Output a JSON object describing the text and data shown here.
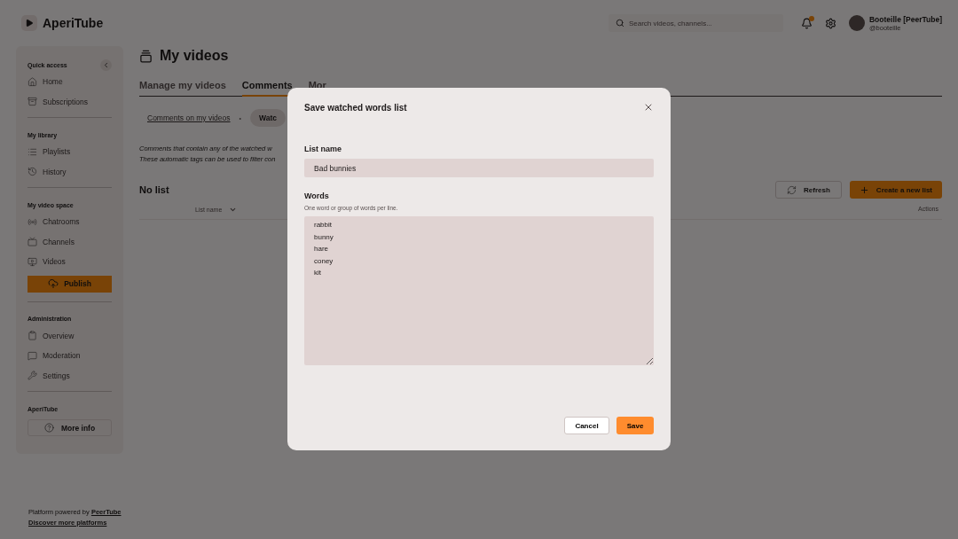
{
  "header": {
    "logo": "AperiTube",
    "search": {
      "placeholder": "Search videos, channels..."
    },
    "notifications": {
      "unread": true
    },
    "user": {
      "name": "Booteille [PeerTube]",
      "handle": "@booteille"
    }
  },
  "sidebar": {
    "sections": [
      {
        "title": "Quick access",
        "items": [
          "Home",
          "Subscriptions"
        ]
      },
      {
        "title": "My library",
        "items": [
          "Playlists",
          "History"
        ]
      },
      {
        "title": "My video space",
        "items": [
          "Chatrooms",
          "Channels",
          "Videos"
        ],
        "action": "Publish"
      },
      {
        "title": "Administration",
        "items": [
          "Overview",
          "Moderation",
          "Settings"
        ]
      },
      {
        "title": "AperiTube",
        "action": "More info"
      }
    ]
  },
  "footer": {
    "powered": "Platform powered by",
    "powered_link": "PeerTube",
    "discover": "Discover more platforms"
  },
  "page": {
    "title": "My videos",
    "tabs": [
      {
        "label": "Manage my videos",
        "selected": false
      },
      {
        "label": "Comments",
        "selected": true
      },
      {
        "label": "Mor",
        "selected": false
      }
    ],
    "subtabs": [
      {
        "label": "Comments on my videos",
        "selected": false
      },
      {
        "label": "Watc",
        "selected": true
      }
    ],
    "separator": "•",
    "description": [
      "Comments that contain any of the watched w",
      "These automatic tags can be used to filter con"
    ],
    "list_title": "No list",
    "refresh": "Refresh",
    "create": "Create a new list",
    "columns": [
      "List name",
      "Actions"
    ]
  },
  "modal": {
    "title": "Save watched words list",
    "name_label": "List name",
    "name_value": "Bad bunnies",
    "words_label": "Words",
    "words_hint": "One word or group of words per line.",
    "words": [
      "rabbit",
      "bunny",
      "hare",
      "coney",
      "kit"
    ],
    "cancel": "Cancel",
    "save": "Save"
  }
}
